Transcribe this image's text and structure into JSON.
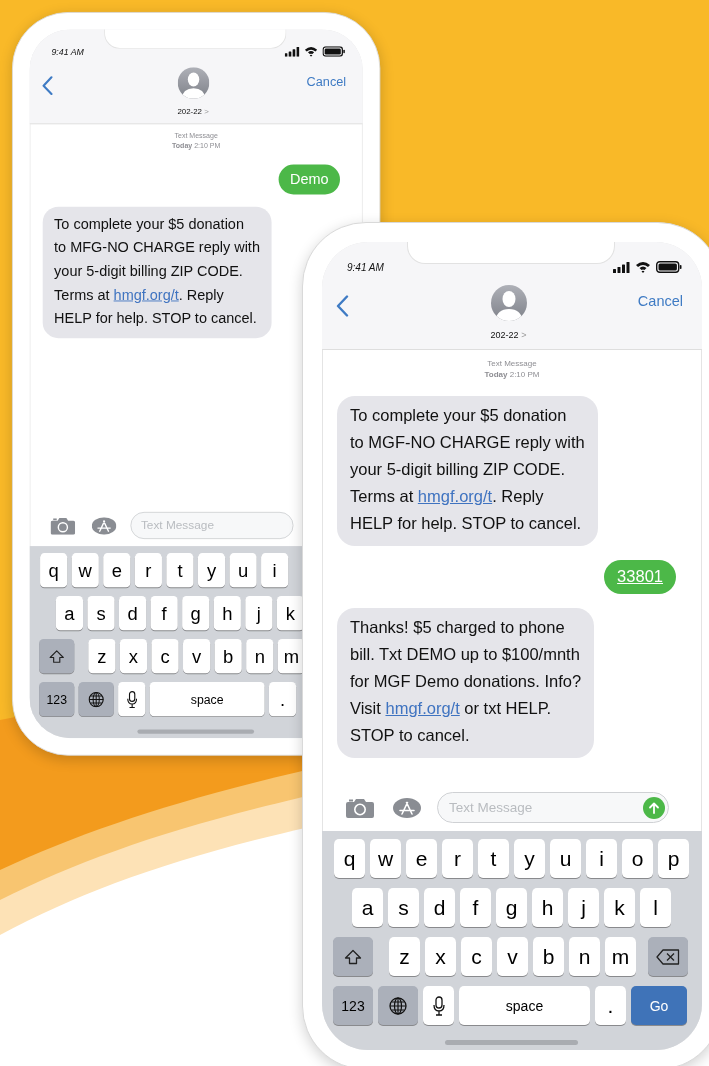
{
  "phones": [
    {
      "status_time": "9:41 AM",
      "contact": "202-22",
      "contact_chevron": ">",
      "cancel": "Cancel",
      "timestamp": {
        "label": "Text Message",
        "time": "**Today** 2:10 PM"
      },
      "messages": [
        {
          "kind": "sent",
          "parts": [
            {
              "kind": "text",
              "text": "Demo"
            }
          ]
        },
        {
          "kind": "received",
          "parts": [
            {
              "kind": "text",
              "text": "To complete your $5 donation\nto MFG-NO CHARGE reply with\nyour 5-digit billing ZIP CODE.\nTerms at "
            },
            {
              "kind": "link",
              "text": "hmgf.org/t"
            },
            {
              "kind": "text",
              "text": ". Reply\nHELP for help. STOP to cancel."
            }
          ]
        }
      ],
      "composer": {
        "placeholder": "Text Message"
      },
      "keyboard": [
        [
          {
            "kind": "letter",
            "label": "q"
          },
          {
            "kind": "letter",
            "label": "w"
          },
          {
            "kind": "letter",
            "label": "e"
          },
          {
            "kind": "letter",
            "label": "r"
          },
          {
            "kind": "letter",
            "label": "t"
          },
          {
            "kind": "letter",
            "label": "y"
          },
          {
            "kind": "letter",
            "label": "u"
          },
          {
            "kind": "letter",
            "label": "i"
          }
        ],
        [
          {
            "kind": "letter",
            "label": "a"
          },
          {
            "kind": "letter",
            "label": "s"
          },
          {
            "kind": "letter",
            "label": "d"
          },
          {
            "kind": "letter",
            "label": "f"
          },
          {
            "kind": "letter",
            "label": "g"
          },
          {
            "kind": "letter",
            "label": "h"
          },
          {
            "kind": "letter",
            "label": "j"
          },
          {
            "kind": "letter",
            "label": "k"
          }
        ],
        [
          {
            "kind": "shift"
          },
          {
            "kind": "letter",
            "label": "z"
          },
          {
            "kind": "letter",
            "label": "x"
          },
          {
            "kind": "letter",
            "label": "c"
          },
          {
            "kind": "letter",
            "label": "v"
          },
          {
            "kind": "letter",
            "label": "b"
          },
          {
            "kind": "letter",
            "label": "n"
          },
          {
            "kind": "letter",
            "label": "m"
          }
        ],
        [
          {
            "kind": "numbers",
            "label": "123"
          },
          {
            "kind": "globe"
          },
          {
            "kind": "mic"
          },
          {
            "kind": "space",
            "label": "space"
          },
          {
            "kind": "letter",
            "label": "."
          }
        ]
      ]
    },
    {
      "status_time": "9:41 AM",
      "contact": "202-22",
      "contact_chevron": ">",
      "cancel": "Cancel",
      "timestamp": {
        "label": "Text Message",
        "time": "**Today** 2:10 PM"
      },
      "messages": [
        {
          "kind": "received",
          "parts": [
            {
              "kind": "text",
              "text": "To complete your $5 donation\nto MGF-NO CHARGE reply with\nyour 5-digit billing ZIP CODE.\nTerms at "
            },
            {
              "kind": "link",
              "text": "hmgf.org/t"
            },
            {
              "kind": "text",
              "text": ". Reply\nHELP for help. STOP to cancel."
            }
          ]
        },
        {
          "kind": "sent",
          "parts": [
            {
              "kind": "link",
              "text": "33801"
            }
          ]
        },
        {
          "kind": "received",
          "parts": [
            {
              "kind": "text",
              "text": "Thanks! $5 charged to phone\nbill. Txt DEMO up to $100/mnth\nfor MGF Demo donations. Info?\nVisit "
            },
            {
              "kind": "link",
              "text": "hmgf.org/t"
            },
            {
              "kind": "text",
              "text": " or txt HELP.\nSTOP to cancel."
            }
          ]
        }
      ],
      "composer": {
        "placeholder": "Text Message",
        "send_visible": true
      },
      "keyboard": [
        [
          {
            "kind": "letter",
            "label": "q"
          },
          {
            "kind": "letter",
            "label": "w"
          },
          {
            "kind": "letter",
            "label": "e"
          },
          {
            "kind": "letter",
            "label": "r"
          },
          {
            "kind": "letter",
            "label": "t"
          },
          {
            "kind": "letter",
            "label": "y"
          },
          {
            "kind": "letter",
            "label": "u"
          },
          {
            "kind": "letter",
            "label": "i"
          },
          {
            "kind": "letter",
            "label": "o"
          },
          {
            "kind": "letter",
            "label": "p"
          }
        ],
        [
          {
            "kind": "letter",
            "label": "a"
          },
          {
            "kind": "letter",
            "label": "s"
          },
          {
            "kind": "letter",
            "label": "d"
          },
          {
            "kind": "letter",
            "label": "f"
          },
          {
            "kind": "letter",
            "label": "g"
          },
          {
            "kind": "letter",
            "label": "h"
          },
          {
            "kind": "letter",
            "label": "j"
          },
          {
            "kind": "letter",
            "label": "k"
          },
          {
            "kind": "letter",
            "label": "l"
          }
        ],
        [
          {
            "kind": "shift"
          },
          {
            "kind": "letter",
            "label": "z"
          },
          {
            "kind": "letter",
            "label": "x"
          },
          {
            "kind": "letter",
            "label": "c"
          },
          {
            "kind": "letter",
            "label": "v"
          },
          {
            "kind": "letter",
            "label": "b"
          },
          {
            "kind": "letter",
            "label": "n"
          },
          {
            "kind": "letter",
            "label": "m"
          },
          {
            "kind": "delete"
          }
        ],
        [
          {
            "kind": "numbers",
            "label": "123"
          },
          {
            "kind": "globe"
          },
          {
            "kind": "mic"
          },
          {
            "kind": "space",
            "label": "space"
          },
          {
            "kind": "letter",
            "label": "."
          },
          {
            "kind": "go",
            "label": "Go"
          }
        ]
      ]
    }
  ]
}
